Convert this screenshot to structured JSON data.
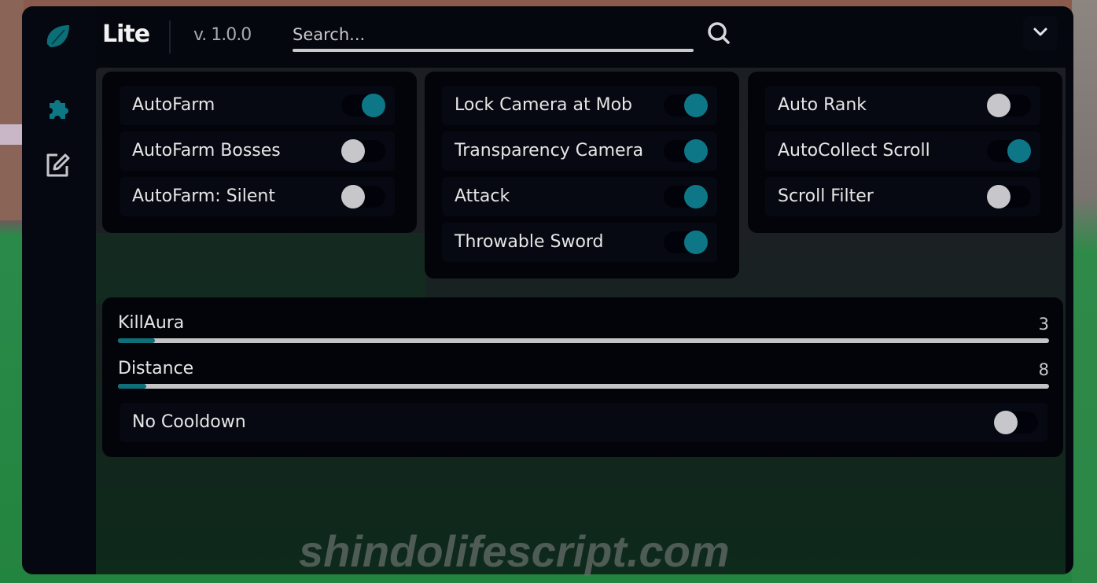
{
  "app": {
    "title": "Lite",
    "version": "v. 1.0.0",
    "accent_color": "#0e7787"
  },
  "search": {
    "placeholder": "Search...",
    "value": ""
  },
  "sidebar": {
    "items": [
      {
        "icon": "puzzle-icon",
        "active": true
      },
      {
        "icon": "edit-icon",
        "active": false
      }
    ]
  },
  "sections": [
    {
      "toggles": [
        {
          "label": "AutoFarm",
          "on": true
        },
        {
          "label": "AutoFarm Bosses",
          "on": false
        },
        {
          "label": "AutoFarm: Silent",
          "on": false
        }
      ]
    },
    {
      "toggles": [
        {
          "label": "Lock Camera at Mob",
          "on": true
        },
        {
          "label": "Transparency Camera",
          "on": true
        },
        {
          "label": "Attack",
          "on": true
        },
        {
          "label": "Throwable Sword",
          "on": true
        }
      ]
    },
    {
      "toggles": [
        {
          "label": "Auto Rank",
          "on": false
        },
        {
          "label": "AutoCollect Scroll",
          "on": true
        },
        {
          "label": "Scroll Filter",
          "on": false
        }
      ]
    }
  ],
  "combat": {
    "sliders": [
      {
        "label": "KillAura",
        "value": "3",
        "fill_fraction": 0.04
      },
      {
        "label": "Distance",
        "value": "8",
        "fill_fraction": 0.03
      }
    ],
    "toggles": [
      {
        "label": "No Cooldown",
        "on": false
      }
    ]
  },
  "watermark": "shindolifescript.com"
}
